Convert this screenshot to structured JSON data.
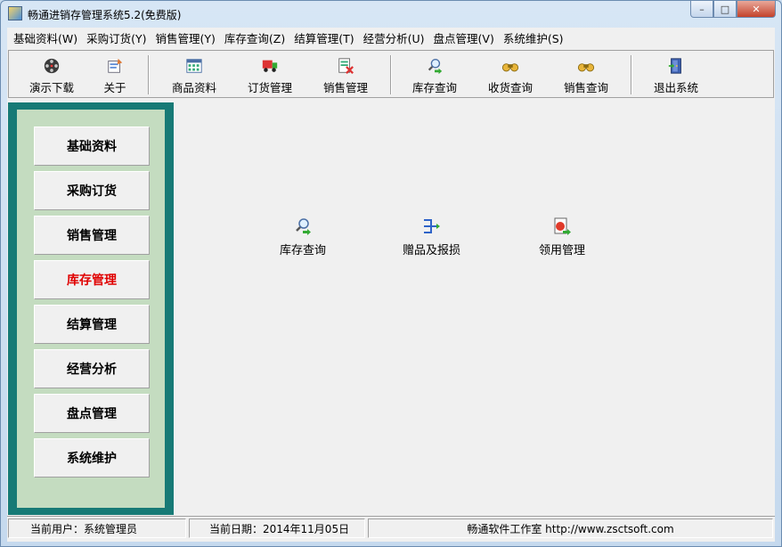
{
  "window": {
    "title": "畅通进销存管理系统5.2(免费版)"
  },
  "menu": [
    "基础资料(W)",
    "采购订货(Y)",
    "销售管理(Y)",
    "库存查询(Z)",
    "结算管理(T)",
    "经营分析(U)",
    "盘点管理(V)",
    "系统维护(S)"
  ],
  "toolbar": [
    {
      "label": "演示下载",
      "icon": "film-reel-icon"
    },
    {
      "label": "关于",
      "icon": "about-icon"
    },
    {
      "label": "商品资料",
      "icon": "product-grid-icon"
    },
    {
      "label": "订货管理",
      "icon": "delivery-truck-icon"
    },
    {
      "label": "销售管理",
      "icon": "sales-document-icon"
    },
    {
      "label": "库存查询",
      "icon": "magnifier-icon"
    },
    {
      "label": "收货查询",
      "icon": "binoculars-icon"
    },
    {
      "label": "销售查询",
      "icon": "binoculars-icon"
    },
    {
      "label": "退出系统",
      "icon": "exit-door-icon"
    }
  ],
  "nav": [
    {
      "label": "基础资料",
      "active": false
    },
    {
      "label": "采购订货",
      "active": false
    },
    {
      "label": "销售管理",
      "active": false
    },
    {
      "label": "库存管理",
      "active": true
    },
    {
      "label": "结算管理",
      "active": false
    },
    {
      "label": "经营分析",
      "active": false
    },
    {
      "label": "盘点管理",
      "active": false
    },
    {
      "label": "系统维护",
      "active": false
    }
  ],
  "actions": [
    {
      "label": "库存查询",
      "icon": "magnifier-icon"
    },
    {
      "label": "赠品及报损",
      "icon": "branch-arrow-icon"
    },
    {
      "label": "领用管理",
      "icon": "document-refresh-icon"
    }
  ],
  "status": {
    "user": "当前用户：系统管理员",
    "date": "当前日期：2014年11月05日",
    "company": "畅通软件工作室 http://www.zsctsoft.com"
  },
  "colors": {
    "nav_frame": "#177a76",
    "nav_inner": "#c4dcc0",
    "active_text": "#e00000"
  }
}
